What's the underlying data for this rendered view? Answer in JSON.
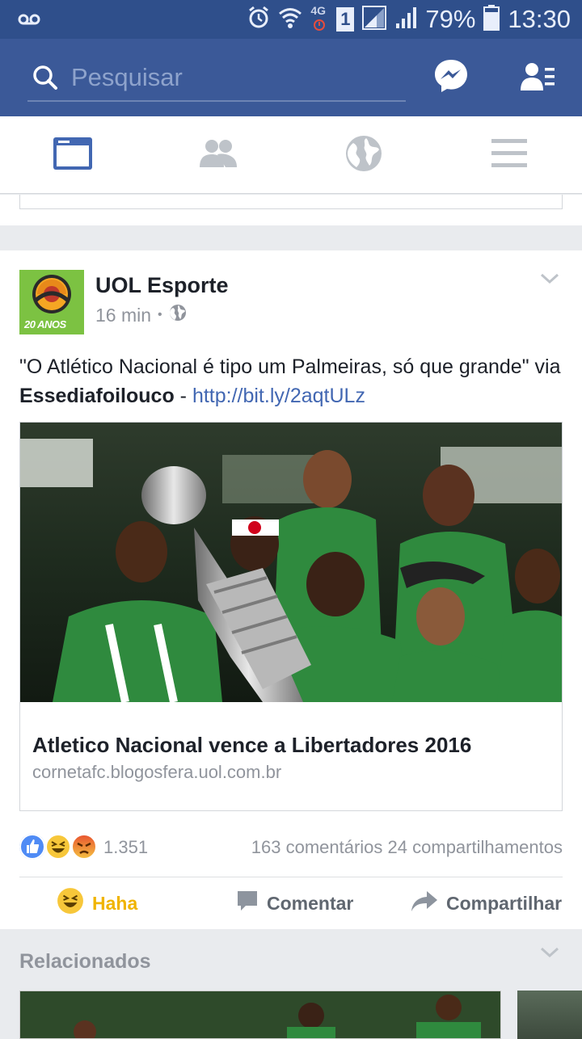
{
  "status_bar": {
    "network": "4G",
    "sim": "1",
    "battery": "79%",
    "time": "13:30"
  },
  "header": {
    "search_placeholder": "Pesquisar"
  },
  "post": {
    "author": "UOL Esporte",
    "avatar_text": "20 ANOS",
    "time": "16 min",
    "dot": "•",
    "text_before": "\"O Atlético Nacional é tipo um Palmeiras, só que grande\" via ",
    "text_bold": "Essediafoilouco",
    "text_sep": " - ",
    "text_link": "http://bit.ly/2aqtULz",
    "link_title": "Atletico Nacional vence a Libertadores 2016",
    "link_domain": "cornetafc.blogosfera.uol.com.br",
    "reaction_count": "1.351",
    "comments": "163 comentários",
    "shares": "24 compartilhamentos",
    "actions": {
      "haha": "Haha",
      "comment": "Comentar",
      "share": "Compartilhar"
    }
  },
  "related": {
    "title": "Relacionados"
  },
  "colors": {
    "brand": "#3b5998",
    "status_bar": "#2f4f8b",
    "link": "#4267b2",
    "haha": "#f0b400"
  }
}
